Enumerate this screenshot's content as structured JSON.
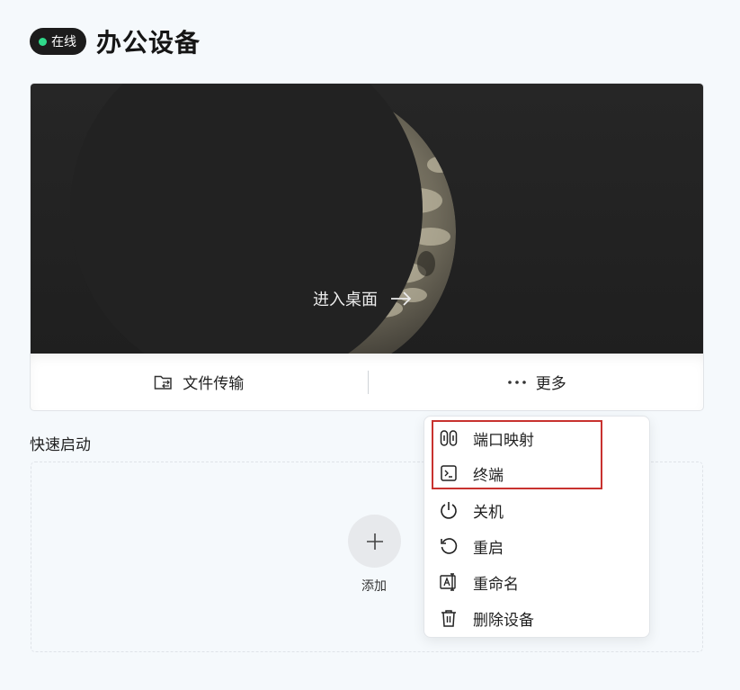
{
  "header": {
    "status": "在线",
    "title": "办公设备"
  },
  "preview": {
    "enter_label": "进入桌面"
  },
  "actions": {
    "file_transfer": "文件传输",
    "more": "更多"
  },
  "quick_start": {
    "title": "快速启动",
    "add_label": "添加"
  },
  "menu": {
    "items": [
      {
        "label": "端口映射",
        "icon": "port-mapping-icon"
      },
      {
        "label": "终端",
        "icon": "terminal-icon"
      },
      {
        "label": "关机",
        "icon": "power-icon"
      },
      {
        "label": "重启",
        "icon": "restart-icon"
      },
      {
        "label": "重命名",
        "icon": "rename-icon"
      },
      {
        "label": "删除设备",
        "icon": "trash-icon"
      }
    ]
  },
  "colors": {
    "online_dot": "#2fd98a",
    "highlight_border": "#c8322f",
    "pill_bg": "#1c1c1c"
  }
}
